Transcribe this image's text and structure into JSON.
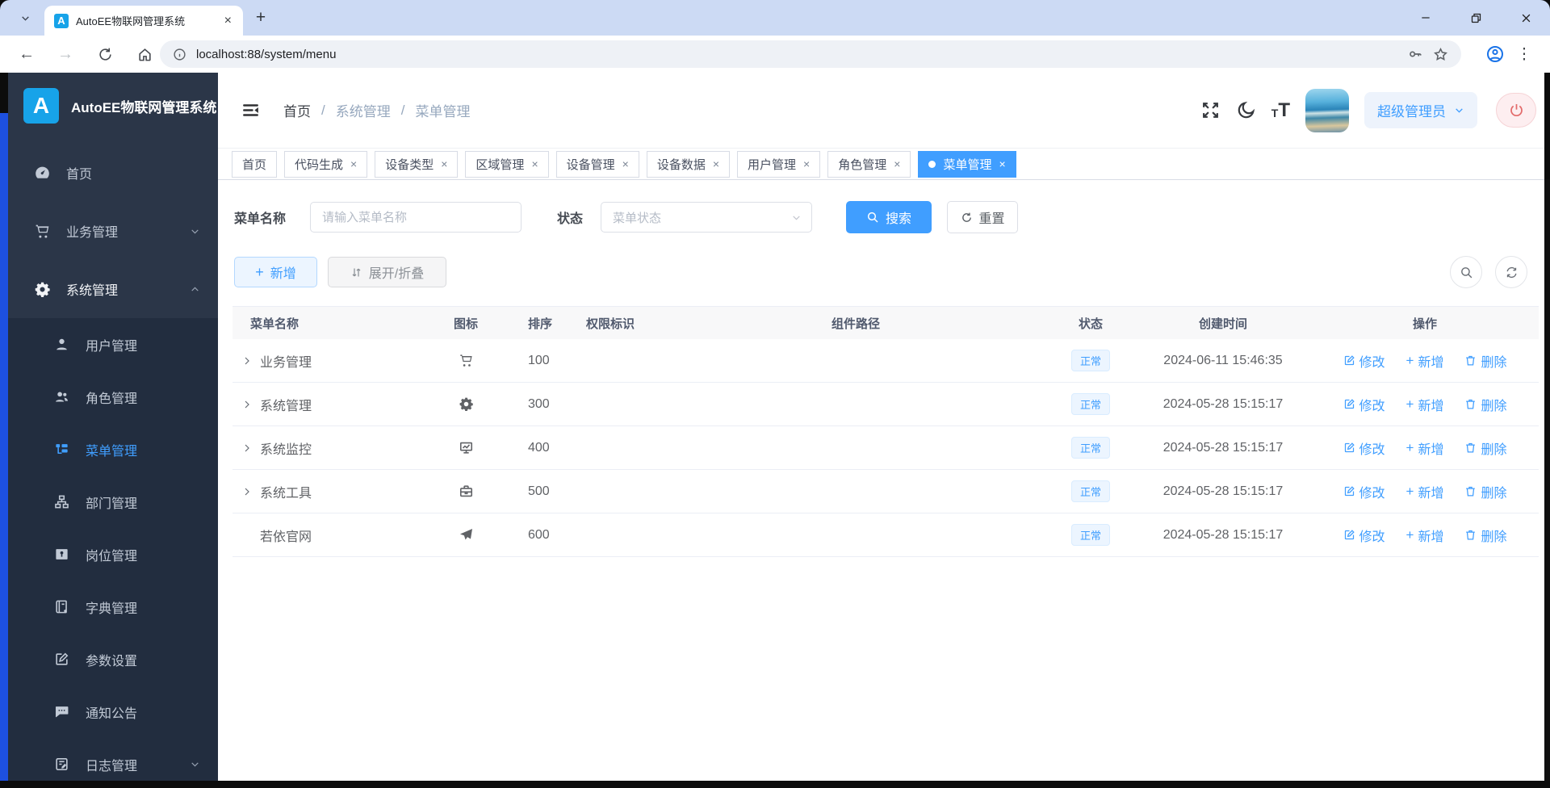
{
  "browser": {
    "tab_title": "AutoEE物联网管理系统",
    "favicon_letter": "A",
    "url": "localhost:88/system/menu"
  },
  "sidebar": {
    "logo_letter": "A",
    "title": "AutoEE物联网管理系统",
    "items": [
      {
        "label": "首页",
        "icon": "dashboard-icon"
      },
      {
        "label": "业务管理",
        "icon": "cart-icon"
      },
      {
        "label": "系统管理",
        "icon": "gear-icon"
      }
    ],
    "subitems": [
      {
        "label": "用户管理",
        "icon": "user-icon"
      },
      {
        "label": "角色管理",
        "icon": "peoples-icon"
      },
      {
        "label": "菜单管理",
        "icon": "tree-table-icon"
      },
      {
        "label": "部门管理",
        "icon": "tree-icon"
      },
      {
        "label": "岗位管理",
        "icon": "post-icon"
      },
      {
        "label": "字典管理",
        "icon": "dict-icon"
      },
      {
        "label": "参数设置",
        "icon": "edit-icon"
      },
      {
        "label": "通知公告",
        "icon": "message-icon"
      },
      {
        "label": "日志管理",
        "icon": "log-icon"
      }
    ]
  },
  "navbar": {
    "breadcrumb": [
      "首页",
      "系统管理",
      "菜单管理"
    ],
    "user_role": "超级管理员"
  },
  "tags": {
    "items": [
      {
        "label": "首页",
        "closable": false,
        "active": false
      },
      {
        "label": "代码生成",
        "closable": true,
        "active": false
      },
      {
        "label": "设备类型",
        "closable": true,
        "active": false
      },
      {
        "label": "区域管理",
        "closable": true,
        "active": false
      },
      {
        "label": "设备管理",
        "closable": true,
        "active": false
      },
      {
        "label": "设备数据",
        "closable": true,
        "active": false
      },
      {
        "label": "用户管理",
        "closable": true,
        "active": false
      },
      {
        "label": "角色管理",
        "closable": true,
        "active": false
      },
      {
        "label": "菜单管理",
        "closable": true,
        "active": true
      }
    ]
  },
  "search": {
    "name_label": "菜单名称",
    "name_placeholder": "请输入菜单名称",
    "status_label": "状态",
    "status_placeholder": "菜单状态",
    "search_label": "搜索",
    "reset_label": "重置"
  },
  "toolbar": {
    "add_label": "新增",
    "expand_collapse_label": "展开/折叠"
  },
  "table": {
    "headers": [
      "菜单名称",
      "图标",
      "排序",
      "权限标识",
      "组件路径",
      "状态",
      "创建时间",
      "操作"
    ],
    "actions": {
      "edit": "修改",
      "add": "新增",
      "delete": "删除"
    },
    "rows": [
      {
        "name": "业务管理",
        "icon": "cart-icon",
        "order": "100",
        "perms": "",
        "component": "",
        "status": "正常",
        "created": "2024-06-11 15:46:35",
        "expandable": true
      },
      {
        "name": "系统管理",
        "icon": "gear-icon",
        "order": "300",
        "perms": "",
        "component": "",
        "status": "正常",
        "created": "2024-05-28 15:15:17",
        "expandable": true
      },
      {
        "name": "系统监控",
        "icon": "monitor-icon",
        "order": "400",
        "perms": "",
        "component": "",
        "status": "正常",
        "created": "2024-05-28 15:15:17",
        "expandable": true
      },
      {
        "name": "系统工具",
        "icon": "toolbox-icon",
        "order": "500",
        "perms": "",
        "component": "",
        "status": "正常",
        "created": "2024-05-28 15:15:17",
        "expandable": true
      },
      {
        "name": "若依官网",
        "icon": "guide-icon",
        "order": "600",
        "perms": "",
        "component": "",
        "status": "正常",
        "created": "2024-05-28 15:15:17",
        "expandable": false
      }
    ]
  },
  "colors": {
    "accent": "#409eff",
    "sidebar_bg": "#2b3648",
    "sidebar_submenu_bg": "#222d3f",
    "logo_blue": "#17a3e9",
    "status_badge_bg": "#ecf5ff",
    "danger": "#f56c6c",
    "tabstrip_bg": "#ccdaf4",
    "edge_blue": "#1d50e0"
  }
}
